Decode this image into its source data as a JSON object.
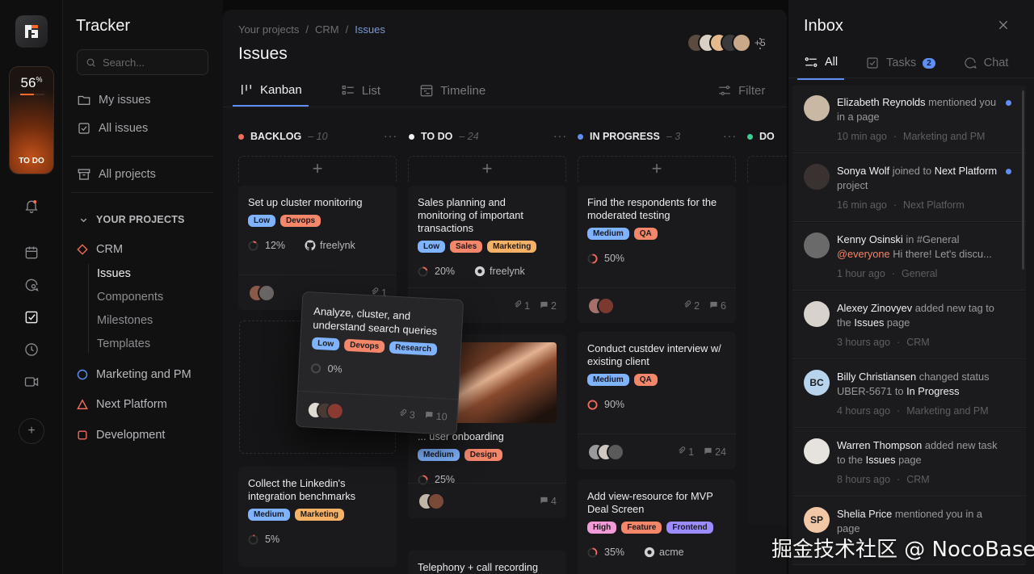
{
  "rail": {
    "progress_value": "56",
    "progress_unit": "%",
    "progress_fraction": 0.56,
    "progress_label": "TO DO",
    "icons": [
      "bell-icon",
      "calendar-icon",
      "chat-search-icon",
      "checkbox-icon",
      "clock-icon",
      "video-icon"
    ],
    "add_label": "+"
  },
  "sidebar": {
    "title": "Tracker",
    "search_placeholder": "Search...",
    "nav": {
      "my_issues": "My issues",
      "all_issues": "All issues",
      "all_projects": "All projects"
    },
    "section_title": "YOUR PROJECTS",
    "projects": [
      {
        "name": "CRM",
        "color": "#f26b5b",
        "shape": "diamond"
      },
      {
        "name": "Marketing and PM",
        "color": "#5d8ff7",
        "shape": "circle"
      },
      {
        "name": "Next Platform",
        "color": "#f26b5b",
        "shape": "triangle"
      },
      {
        "name": "Development",
        "color": "#f26b5b",
        "shape": "square"
      }
    ],
    "crm_sub": [
      "Issues",
      "Components",
      "Milestones",
      "Templates"
    ]
  },
  "main": {
    "breadcrumb": [
      "Your projects",
      "CRM",
      "Issues"
    ],
    "breadcrumb_sep": "/",
    "title": "Issues",
    "members_more": "+5",
    "tabs": [
      "Kanban",
      "List",
      "Timeline"
    ],
    "filter_label": "Filter",
    "add_label": "+"
  },
  "columns": [
    {
      "name": "BACKLOG",
      "count": "– 10",
      "color": "#f26b5b"
    },
    {
      "name": "TO DO",
      "count": "– 24",
      "color": "#f0f0f2"
    },
    {
      "name": "IN PROGRESS",
      "count": "– 3",
      "color": "#5d8ff7"
    },
    {
      "name": "DO",
      "count": "",
      "color": "#3ccf91"
    }
  ],
  "cards": {
    "b1": {
      "title": "Set up cluster monitoring",
      "tags": [
        "Low",
        "Devops"
      ],
      "progress": "12%",
      "repo": "freelynk",
      "attach": "1"
    },
    "b2": {
      "title": "Collect the Linkedin's integration benchmarks",
      "tags": [
        "Medium",
        "Marketing"
      ],
      "progress": "5%"
    },
    "t1": {
      "title": "Sales planning and monitoring of important transactions",
      "tags": [
        "Low",
        "Sales",
        "Marketing"
      ],
      "progress": "20%",
      "repo": "freelynk",
      "attach": "1",
      "comments": "2"
    },
    "t2": {
      "title": "... user onboarding",
      "tags": [
        "Medium",
        "Design"
      ],
      "progress": "25%",
      "comments": "4"
    },
    "t3": {
      "title": "Telephony + call recording"
    },
    "p1": {
      "title": "Find the respondents for the moderated testing",
      "tags": [
        "Medium",
        "QA"
      ],
      "progress": "50%",
      "attach": "2",
      "comments": "6"
    },
    "p2": {
      "title": "Conduct custdev interview w/ existing client",
      "tags": [
        "Medium",
        "QA"
      ],
      "progress": "90%",
      "attach": "1",
      "comments": "24"
    },
    "p3": {
      "title": "Add view-resource for MVP Deal Screen",
      "tags": [
        "High",
        "Feature",
        "Frontend"
      ],
      "progress": "35%",
      "repo": "acme"
    },
    "drag": {
      "title": "Analyze, cluster, and understand search queries",
      "tags": [
        "Low",
        "Devops",
        "Research"
      ],
      "progress": "0%",
      "attach": "3",
      "comments": "10"
    }
  },
  "tag_colors": {
    "Low": "#7fb3ff",
    "Devops": "#f4866a",
    "Sales": "#f4866a",
    "Marketing": "#f5b266",
    "Medium": "#7fb3ff",
    "QA": "#f4866a",
    "Design": "#f4866a",
    "High": "#f39bd9",
    "Feature": "#f4866a",
    "Frontend": "#9b8cff",
    "Research": "#7fb3ff"
  },
  "inbox": {
    "title": "Inbox",
    "tabs": [
      {
        "label": "All"
      },
      {
        "label": "Tasks",
        "badge": "2"
      },
      {
        "label": "Chat"
      }
    ],
    "items": [
      {
        "name": "Elizabeth Reynolds",
        "pre": " mentioned you in a page",
        "time": "10 min ago",
        "ctx": "Marketing and PM",
        "unread": true,
        "avatar": "#c9b8a4"
      },
      {
        "name": "Sonya Wolf",
        "pre": " joined to ",
        "hl": "Next Platform",
        "post": " project",
        "time": "16 min ago",
        "ctx": "Next Platform",
        "unread": true,
        "avatar": "#3a3230"
      },
      {
        "name": "Kenny Osinski",
        "pre": " in #General ",
        "mention": "@everyone",
        "post": " Hi there! Let's discu...",
        "time": "1 hour ago",
        "ctx": "General",
        "unread": false,
        "avatar": "#6a6a6a"
      },
      {
        "name": "Alexey Zinovyev",
        "pre": " added new tag to the ",
        "hl": "Issues",
        "post": " page",
        "time": "3 hours ago",
        "ctx": "CRM",
        "unread": false,
        "avatar": "#d8d2cc"
      },
      {
        "name": "Billy Christiansen",
        "pre": " changed status UBER-5671 to ",
        "hl": "In Progress",
        "post": "",
        "time": "4 hours ago",
        "ctx": "Marketing and PM",
        "unread": false,
        "avatar": "#b8d4ec",
        "initials": "BC"
      },
      {
        "name": "Warren Thompson",
        "pre": " added new task to the ",
        "hl": "Issues",
        "post": " page",
        "time": "8 hours ago",
        "ctx": "CRM",
        "unread": false,
        "avatar": "#e6e2de"
      },
      {
        "name": "Shelia Price",
        "pre": " mentioned you in a page",
        "time": "",
        "ctx": "",
        "unread": false,
        "avatar": "#f2c7a6",
        "initials": "SP"
      }
    ],
    "sep": "·"
  },
  "watermark": "掘金技术社区 @ NocoBase"
}
